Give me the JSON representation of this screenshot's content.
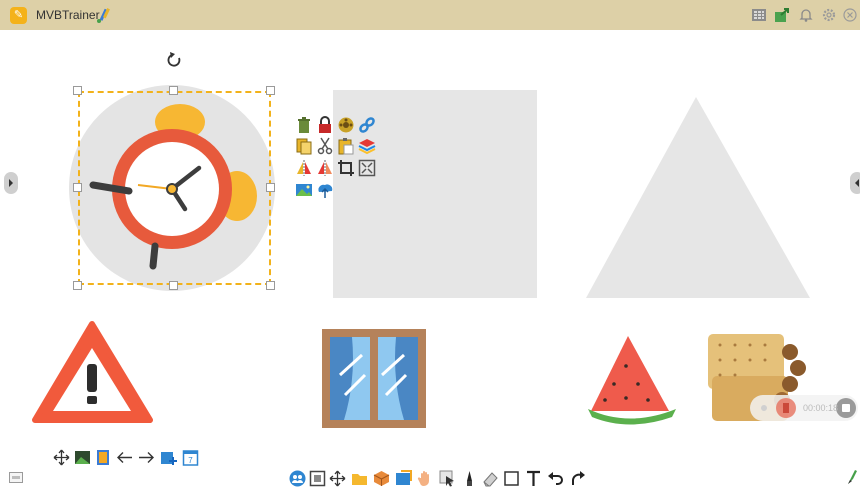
{
  "app": {
    "title": "MVBTrainer"
  },
  "recorder": {
    "time": "00:00:18"
  },
  "icons": {
    "titlebar": [
      "app-logo-icon",
      "pen-tool-icon",
      "grid-icon",
      "export-icon",
      "bell-icon",
      "gear-icon",
      "close-icon"
    ],
    "context_menu": [
      "trash-icon",
      "lock-icon",
      "film-icon",
      "link-icon",
      "copy-icon",
      "cut-icon",
      "paste-icon",
      "layers-icon",
      "flip-horizontal-icon",
      "flip-vertical-icon",
      "crop-icon",
      "fit-icon",
      "image-icon",
      "upload-icon"
    ],
    "left_toolbar": [
      "move-icon",
      "image-icon",
      "book-icon",
      "arrow-left-icon",
      "arrow-right-icon",
      "add-page-icon",
      "calendar-icon"
    ],
    "bottom_toolbar": [
      "people-icon",
      "frame-icon",
      "move-icon",
      "folder-icon",
      "box-icon",
      "cube-icon",
      "hand-icon",
      "select-icon",
      "pen-icon",
      "eraser-icon",
      "rectangle-icon",
      "text-icon",
      "undo-icon",
      "redo-icon"
    ]
  },
  "colors": {
    "titlebar": "#ddd0a7",
    "selection": "#f2b21b",
    "clock_ring": "#e75a3c",
    "bell": "#f7b733",
    "placeholder": "#e6e6e6",
    "warning": "#f15a3c",
    "window_frame": "#b5825a",
    "curtain": "#4a87c4",
    "watermelon": "#ef5b4c",
    "biscuit": "#e5c17a"
  }
}
